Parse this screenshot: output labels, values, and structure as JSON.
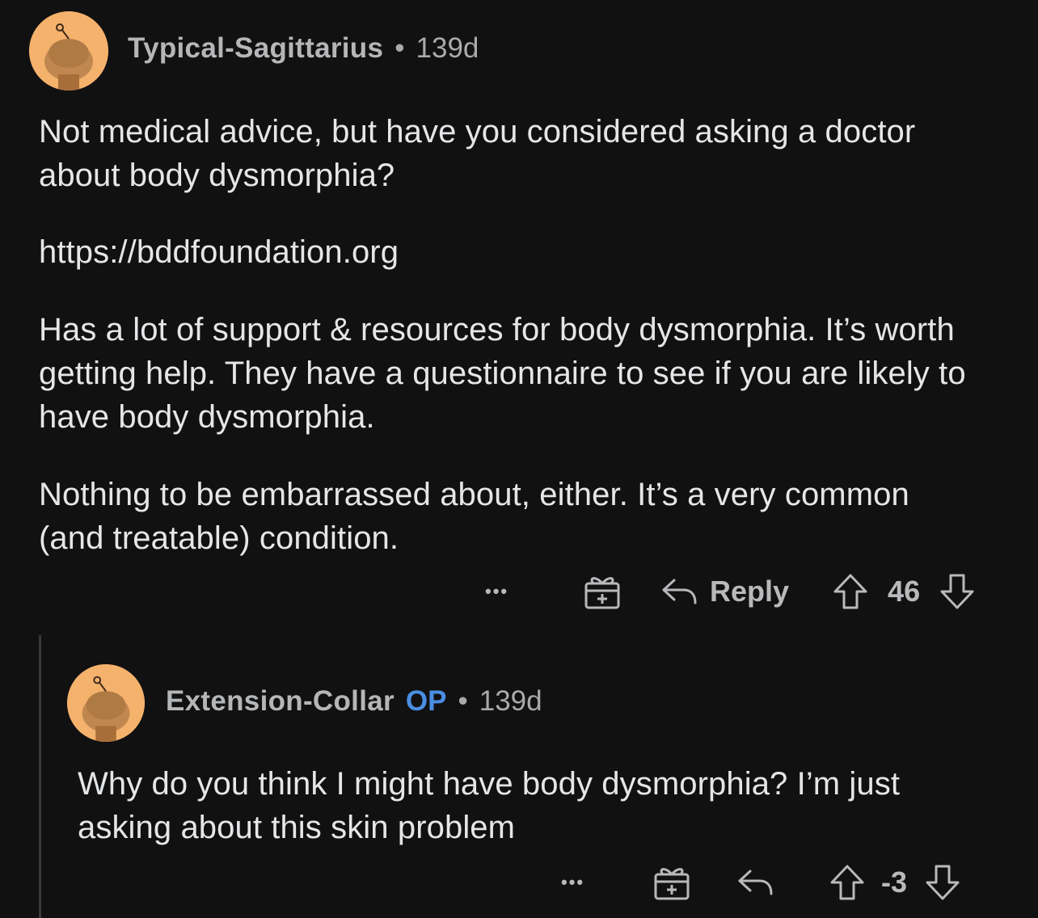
{
  "comments": [
    {
      "username": "Typical-Sagittarius",
      "separator": "•",
      "age": "139d",
      "paragraphs": [
        "Not medical advice, but have you considered asking a doctor about body dysmorphia?",
        "https://bddfoundation.org",
        "Has a lot of support & resources for body dysmorphia. It’s worth getting help. They have a questionnaire to see if you are likely to have body dysmorphia.",
        "Nothing to be embarrassed about, either. It’s a very common (and treatable) condition."
      ],
      "more_label": "•••",
      "reply_label": "Reply",
      "score": "46"
    },
    {
      "username": "Extension-Collar",
      "op_badge": "OP",
      "separator": "•",
      "age": "139d",
      "paragraphs": [
        "Why do you think I might have body dysmorphia? I’m just asking about this skin problem"
      ],
      "more_label": "•••",
      "score": "-3"
    }
  ],
  "colors": {
    "background": "#111112",
    "link": "#4a90e2",
    "op_badge": "#4a8ee3",
    "avatar": "#f5b26c"
  },
  "icons": [
    "award-icon",
    "reply-icon",
    "upvote-icon",
    "downvote-icon",
    "avatar-snoo-icon"
  ]
}
